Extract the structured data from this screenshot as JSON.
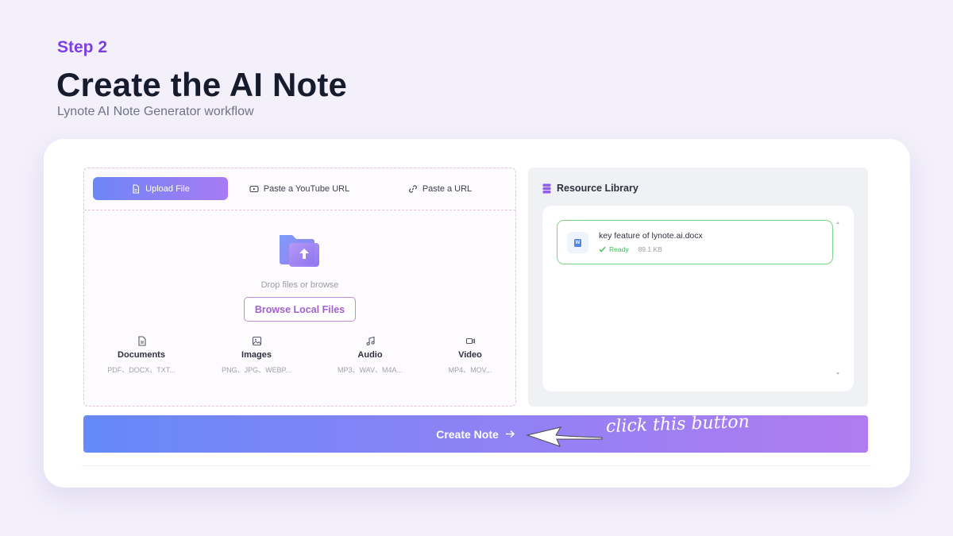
{
  "header": {
    "step": "Step 2",
    "title": "Create the AI Note",
    "subtitle": "Lynote AI Note Generator workflow"
  },
  "upload": {
    "tabs": [
      {
        "label": "Upload File",
        "icon": "file-icon",
        "active": true
      },
      {
        "label": "Paste a YouTube URL",
        "icon": "youtube-icon",
        "active": false
      },
      {
        "label": "Paste a URL",
        "icon": "link-icon",
        "active": false
      }
    ],
    "drop_text": "Drop files or browse",
    "browse_label": "Browse Local Files",
    "file_types": [
      {
        "name": "Documents",
        "exts": "PDF、DOCX、TXT...",
        "icon": "document-icon"
      },
      {
        "name": "Images",
        "exts": "PNG、JPG、WEBP...",
        "icon": "image-icon"
      },
      {
        "name": "Audio",
        "exts": "MP3、WAV、M4A...",
        "icon": "music-icon"
      },
      {
        "name": "Video",
        "exts": "MP4、MOV...",
        "icon": "video-icon"
      }
    ]
  },
  "library": {
    "title": "Resource Library",
    "files": [
      {
        "name": "key feature of lynote.ai.docx",
        "status": "Ready",
        "size": "89.1 KB"
      }
    ]
  },
  "create": {
    "label": "Create Note",
    "annotation": "click this button"
  },
  "colors": {
    "accent_purple": "#7b3fe4",
    "gradient_start": "#6589f8",
    "gradient_end": "#b17cf0",
    "ready_green": "#3ebd55"
  }
}
